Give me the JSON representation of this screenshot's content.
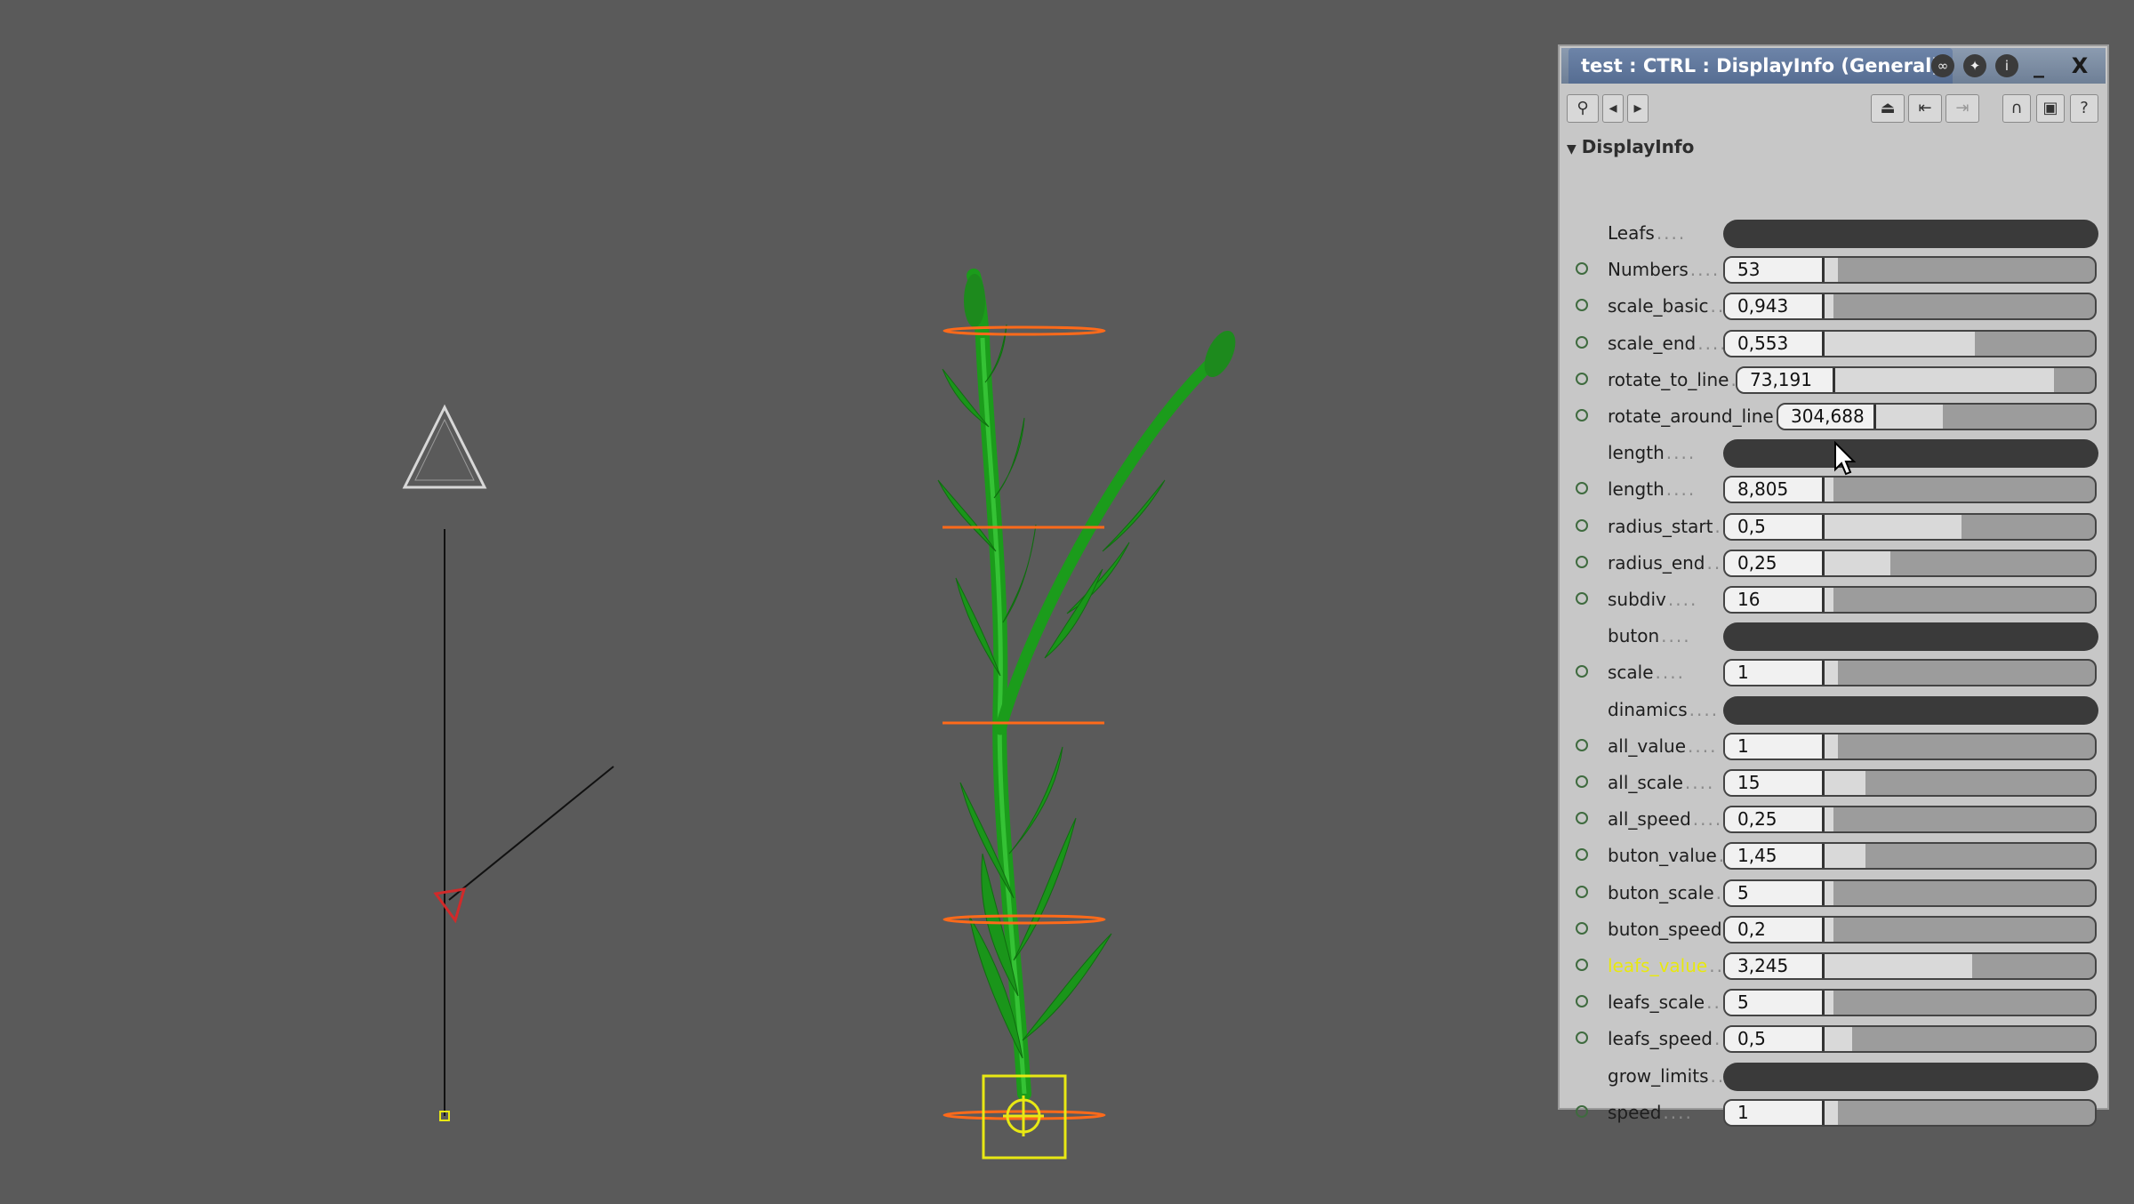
{
  "window": {
    "title": "test : CTRL : DisplayInfo (General)",
    "close_label": "X",
    "minimize_label": "_"
  },
  "section": {
    "label": "DisplayInfo"
  },
  "rows": [
    {
      "type": "group",
      "label": "Leafs"
    },
    {
      "type": "param",
      "label": "Numbers",
      "value": "53",
      "fill": 0.05
    },
    {
      "type": "param",
      "label": "scale_basic",
      "value": "0,943",
      "fill": 0.03
    },
    {
      "type": "param",
      "label": "scale_end",
      "value": "0,553",
      "fill": 0.55
    },
    {
      "type": "param",
      "label": "rotate_to_line",
      "value": "73,191",
      "fill": 0.83
    },
    {
      "type": "param",
      "label": "rotate_around_line",
      "value": "304,688",
      "fill": 0.3
    },
    {
      "type": "group",
      "label": "length"
    },
    {
      "type": "param",
      "label": "length",
      "value": "8,805",
      "fill": 0.02
    },
    {
      "type": "param",
      "label": "radius_start",
      "value": "0,5",
      "fill": 0.5
    },
    {
      "type": "param",
      "label": "radius_end",
      "value": "0,25",
      "fill": 0.24
    },
    {
      "type": "param",
      "label": "subdiv",
      "value": "16",
      "fill": 0.02
    },
    {
      "type": "group",
      "label": "buton"
    },
    {
      "type": "param",
      "label": "scale",
      "value": "1",
      "fill": 0.05
    },
    {
      "type": "group",
      "label": "dinamics"
    },
    {
      "type": "param",
      "label": "all_value",
      "value": "1",
      "fill": 0.05
    },
    {
      "type": "param",
      "label": "all_scale",
      "value": "15",
      "fill": 0.15
    },
    {
      "type": "param",
      "label": "all_speed",
      "value": "0,25",
      "fill": 0.02
    },
    {
      "type": "param",
      "label": "buton_value",
      "value": "1,45",
      "fill": 0.15
    },
    {
      "type": "param",
      "label": "buton_scale",
      "value": "5",
      "fill": 0.02
    },
    {
      "type": "param",
      "label": "buton_speed",
      "value": "0,2",
      "fill": 0.02
    },
    {
      "type": "param",
      "label": "leafs_value",
      "value": "3,245",
      "fill": 0.54,
      "highlight": true
    },
    {
      "type": "param",
      "label": "leafs_scale",
      "value": "5",
      "fill": 0.02
    },
    {
      "type": "param",
      "label": "leafs_speed",
      "value": "0,5",
      "fill": 0.1
    },
    {
      "type": "group",
      "label": "grow_limits"
    },
    {
      "type": "param",
      "label": "speed",
      "value": "1",
      "fill": 0.05
    }
  ],
  "colors": {
    "viewport_bg": "#5a5a5a",
    "highlight_label": "#e8e810",
    "plant_green": "#1fa81f",
    "orange_guides": "#ff6a1a",
    "yellow_handle": "#e8e814",
    "camera_red": "#d12a2a"
  },
  "icons": [
    "wrench-icon",
    "arrow-left-icon",
    "arrow-right-icon",
    "eject-icon",
    "import-icon",
    "export-icon",
    "magnet-icon",
    "frame-icon",
    "help-icon"
  ]
}
